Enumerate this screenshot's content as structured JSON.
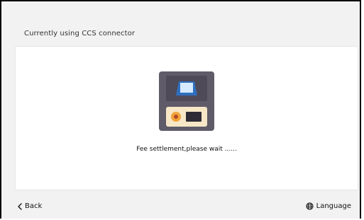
{
  "header": {
    "title": "Currently using CCS connector"
  },
  "status": {
    "message": "Fee settlement,please wait ......"
  },
  "footer": {
    "back_label": "Back",
    "language_label": "Language"
  },
  "icons": {
    "charger": "charger-icon",
    "back": "chevron-left-icon",
    "language": "globe-icon"
  },
  "colors": {
    "charger_body": "#5f5b69",
    "charger_screen": "#ffffff",
    "charger_panel": "#f7e7c7",
    "charger_port": "#f1a33a"
  }
}
